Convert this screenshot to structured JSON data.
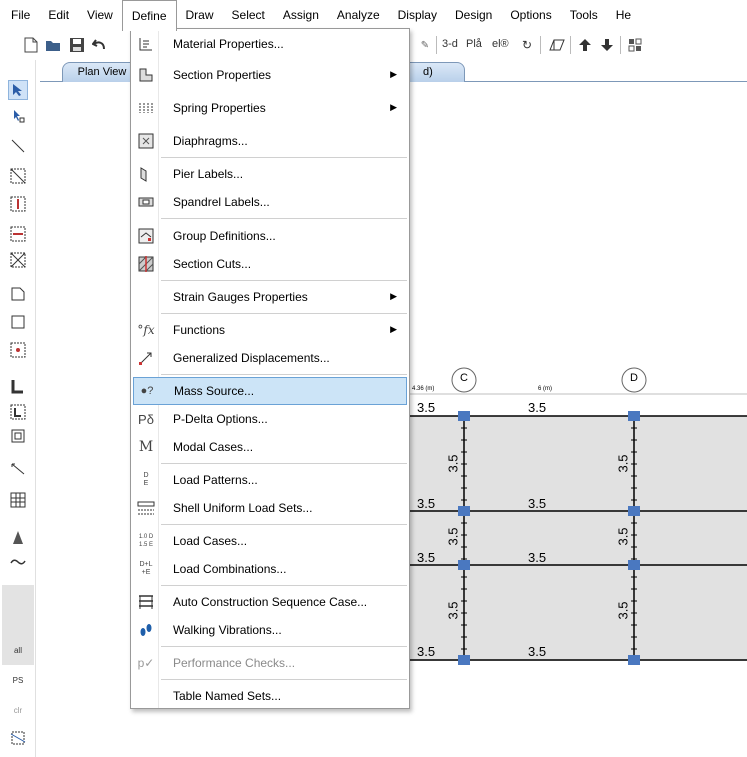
{
  "menubar": [
    {
      "label": "File"
    },
    {
      "label": "Edit"
    },
    {
      "label": "View"
    },
    {
      "label": "Define",
      "active": true
    },
    {
      "label": "Draw"
    },
    {
      "label": "Select"
    },
    {
      "label": "Assign"
    },
    {
      "label": "Analyze"
    },
    {
      "label": "Display"
    },
    {
      "label": "Design"
    },
    {
      "label": "Options"
    },
    {
      "label": "Tools"
    },
    {
      "label": "He"
    }
  ],
  "toolbar": {
    "view3d": "3-d",
    "plan": "Plå",
    "elev": "el®"
  },
  "tabs": {
    "plan_view": "Plan View",
    "other_tab_fragment": "d)"
  },
  "define_menu": {
    "items": [
      {
        "label": "Material Properties...",
        "icon": "material-icon",
        "submenu": false
      },
      {
        "label": "Section Properties",
        "icon": "section-icon",
        "submenu": true
      },
      {
        "label": "Spring Properties",
        "icon": "spring-icon",
        "submenu": true
      },
      {
        "label": "Diaphragms...",
        "icon": "diaphragm-icon",
        "submenu": false
      },
      {
        "label": "Pier Labels...",
        "icon": "pier-icon",
        "submenu": false
      },
      {
        "label": "Spandrel Labels...",
        "icon": "spandrel-icon",
        "submenu": false
      },
      {
        "label": "Group Definitions...",
        "icon": "group-icon",
        "submenu": false
      },
      {
        "label": "Section Cuts...",
        "icon": "section-cut-icon",
        "submenu": false
      },
      {
        "label": "Strain Gauges Properties",
        "icon": "",
        "submenu": true
      },
      {
        "label": "Functions",
        "icon": "function-icon",
        "icon_text": "°fx",
        "submenu": true
      },
      {
        "label": "Generalized Displacements...",
        "icon": "displacement-icon",
        "submenu": false
      },
      {
        "label": "Mass Source...",
        "icon": "mass-icon",
        "icon_text": "●?",
        "submenu": false,
        "highlighted": true
      },
      {
        "label": "P-Delta Options...",
        "icon": "pdelta-icon",
        "icon_text": "Pδ",
        "submenu": false
      },
      {
        "label": "Modal Cases...",
        "icon": "modal-icon",
        "icon_text": "M",
        "submenu": false
      },
      {
        "label": "Load Patterns...",
        "icon": "load-pattern-icon",
        "icon_text": "D\nE",
        "submenu": false
      },
      {
        "label": "Shell Uniform Load Sets...",
        "icon": "shell-load-icon",
        "submenu": false
      },
      {
        "label": "Load Cases...",
        "icon": "load-case-icon",
        "icon_text": "1.0 D\n1.5 E",
        "submenu": false
      },
      {
        "label": "Load Combinations...",
        "icon": "load-combo-icon",
        "icon_text": "D+L\n+E",
        "submenu": false
      },
      {
        "label": "Auto Construction Sequence Case...",
        "icon": "construction-icon",
        "submenu": false
      },
      {
        "label": "Walking Vibrations...",
        "icon": "walking-icon",
        "submenu": false
      },
      {
        "label": "Performance Checks...",
        "icon": "performance-icon",
        "icon_text": "p✓",
        "submenu": false,
        "disabled": true
      },
      {
        "label": "Table Named Sets...",
        "icon": "",
        "submenu": false
      }
    ]
  },
  "plan": {
    "grid_bubbles": [
      "C",
      "D"
    ],
    "span_labels": [
      "4.36 (m)",
      "6 (m)"
    ],
    "dims": {
      "h": "3.5",
      "v": "3.5"
    }
  },
  "left_toolbar": {
    "all": "all",
    "ps": "PS",
    "clr": "clr"
  },
  "colors": {
    "menu_highlight": "#cce4f7",
    "tab": "#b9d0ea",
    "slab_fill": "#e1e1e1",
    "beam": "#000000",
    "column": "#4a78c0"
  }
}
